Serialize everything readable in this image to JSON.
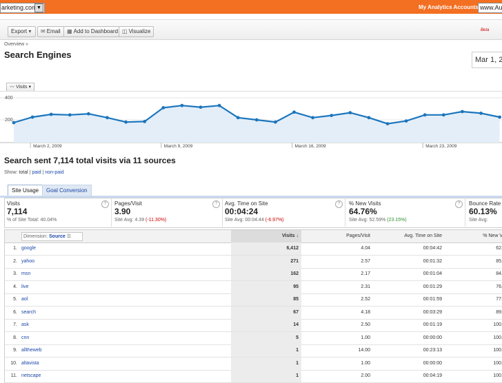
{
  "topbar": {
    "site_value": "arketing.com/",
    "accounts_label": "My Analytics Accounts:",
    "accounts_value": "www.Au"
  },
  "toolbar": {
    "export_label": "Export",
    "email_label": "Email",
    "add_dashboard_label": "Add to Dashboard",
    "visualize_label": "Visualize",
    "beta_label": "Beta"
  },
  "breadcrumb": "Overview »",
  "page_title": "Search Engines",
  "date_range": "Mar 1, 2",
  "chart_control": {
    "metric_label": "Visits"
  },
  "chart_data": {
    "type": "area",
    "series": [
      {
        "name": "Visits",
        "values": [
          175,
          225,
          250,
          245,
          255,
          220,
          180,
          185,
          310,
          330,
          315,
          330,
          220,
          200,
          180,
          270,
          220,
          240,
          265,
          220,
          165,
          190,
          245,
          245,
          275,
          260,
          225
        ]
      }
    ],
    "x_tick_labels": [
      "March 2, 2009",
      "March 9, 2009",
      "March 16, 2009",
      "March 23, 2009"
    ],
    "y_tick_labels": [
      "400",
      "200"
    ],
    "ylim": [
      0,
      430
    ],
    "line_color": "#1b75bc",
    "fill_color": "#e3eef9",
    "grid": true
  },
  "summary": "Search sent 7,114 total visits via 11 sources",
  "show": {
    "label": "Show:",
    "total": "total",
    "paid": "paid",
    "nonpaid": "non-paid",
    "sep": "|"
  },
  "tabs": {
    "site_usage": "Site Usage",
    "goal_conversion": "Goal Conversion"
  },
  "scorecards": [
    {
      "label": "Visits",
      "value": "7,114",
      "sub_prefix": "% of Site Total:",
      "sub_value": "40.04%",
      "sub_delta": ""
    },
    {
      "label": "Pages/Visit",
      "value": "3.90",
      "sub_prefix": "Site Avg:",
      "sub_value": "4.39",
      "sub_delta": "(-11.30%)"
    },
    {
      "label": "Avg. Time on Site",
      "value": "00:04:24",
      "sub_prefix": "Site Avg:",
      "sub_value": "00:04:44",
      "sub_delta": "(-6.97%)"
    },
    {
      "label": "% New Visits",
      "value": "64.76%",
      "sub_prefix": "Site Avg:",
      "sub_value": "52.59%",
      "sub_delta": "(23.15%)"
    },
    {
      "label": "Bounce Rate",
      "value": "60.13%",
      "sub_prefix": "Site Avg:",
      "sub_value": "",
      "sub_delta": ""
    }
  ],
  "table": {
    "dimension_label": "Dimension:",
    "dimension_value": "Source",
    "headers": {
      "visits": "Visits",
      "pages_visit": "Pages/Visit",
      "avg_time": "Avg. Time on Site",
      "new_visits": "% New V"
    },
    "rows": [
      {
        "idx": "1.",
        "source": "google",
        "visits": "6,412",
        "pages": "4.04",
        "time": "00:04:42",
        "new": "62."
      },
      {
        "idx": "2.",
        "source": "yahoo",
        "visits": "271",
        "pages": "2.57",
        "time": "00:01:32",
        "new": "85."
      },
      {
        "idx": "3.",
        "source": "msn",
        "visits": "162",
        "pages": "2.17",
        "time": "00:01:04",
        "new": "84."
      },
      {
        "idx": "4.",
        "source": "live",
        "visits": "95",
        "pages": "2.31",
        "time": "00:01:29",
        "new": "76."
      },
      {
        "idx": "5.",
        "source": "aol",
        "visits": "85",
        "pages": "2.52",
        "time": "00:01:59",
        "new": "77."
      },
      {
        "idx": "6.",
        "source": "search",
        "visits": "67",
        "pages": "4.18",
        "time": "00:03:29",
        "new": "89."
      },
      {
        "idx": "7.",
        "source": "ask",
        "visits": "14",
        "pages": "2.50",
        "time": "00:01:19",
        "new": "100."
      },
      {
        "idx": "8.",
        "source": "cnn",
        "visits": "5",
        "pages": "1.00",
        "time": "00:00:00",
        "new": "100."
      },
      {
        "idx": "9.",
        "source": "alltheweb",
        "visits": "1",
        "pages": "14.00",
        "time": "00:23:13",
        "new": "100."
      },
      {
        "idx": "10.",
        "source": "altavista",
        "visits": "1",
        "pages": "1.00",
        "time": "00:00:00",
        "new": "100."
      },
      {
        "idx": "11.",
        "source": "netscape",
        "visits": "1",
        "pages": "2.00",
        "time": "00:04:19",
        "new": "100."
      }
    ]
  }
}
